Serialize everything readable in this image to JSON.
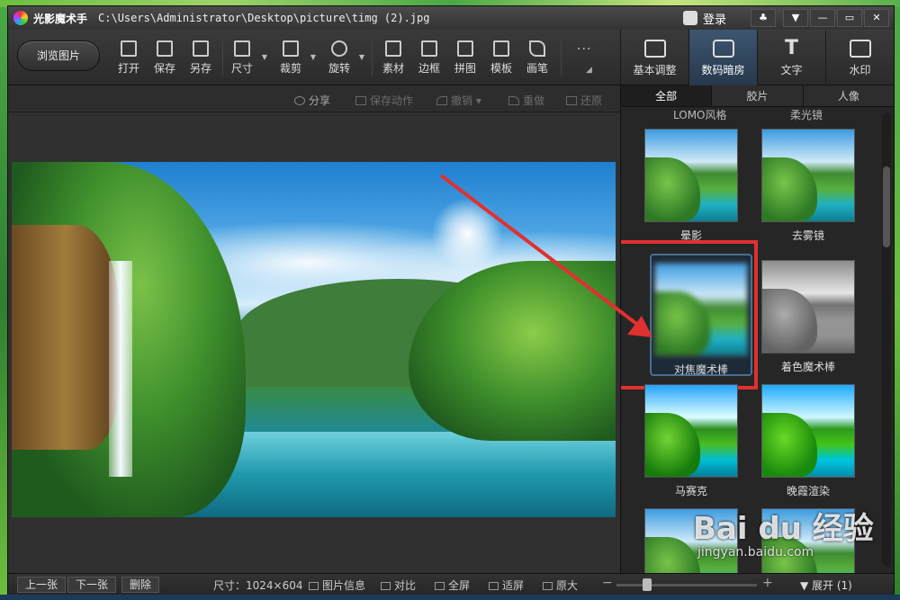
{
  "titlebar": {
    "app_name": "光影魔术手",
    "file_path": "C:\\Users\\Administrator\\Desktop\\picture\\timg (2).jpg",
    "login_label": "登录",
    "controls": [
      "♣",
      "▼",
      "—",
      "▭",
      "✕"
    ]
  },
  "toolbar": {
    "browse_label": "浏览图片",
    "tools": [
      {
        "label": "打开",
        "icon": "open-icon"
      },
      {
        "label": "保存",
        "icon": "save-icon"
      },
      {
        "label": "另存",
        "icon": "save-as-icon"
      },
      {
        "label": "尺寸",
        "icon": "resize-icon"
      },
      {
        "label": "裁剪",
        "icon": "crop-icon"
      },
      {
        "label": "旋转",
        "icon": "rotate-icon"
      },
      {
        "label": "素材",
        "icon": "material-icon"
      },
      {
        "label": "边框",
        "icon": "border-icon"
      },
      {
        "label": "拼图",
        "icon": "collage-icon"
      },
      {
        "label": "模板",
        "icon": "template-icon"
      },
      {
        "label": "画笔",
        "icon": "brush-icon"
      }
    ],
    "more": "···",
    "right_tabs": [
      {
        "label": "基本调整",
        "icon": "edit-icon"
      },
      {
        "label": "数码暗房",
        "icon": "camera-icon"
      },
      {
        "label": "文字",
        "icon": "text-icon",
        "glyph": "T"
      },
      {
        "label": "水印",
        "icon": "watermark-icon"
      }
    ]
  },
  "actions": {
    "share": "分享",
    "save_action": "保存动作",
    "undo": "撤销",
    "redo": "重做",
    "restore": "还原"
  },
  "panel": {
    "tabs": [
      "全部",
      "胶片",
      "人像"
    ],
    "top_labels": [
      "LOMO风格",
      "柔光镜"
    ],
    "items": [
      {
        "label": "晕影",
        "style": "normal"
      },
      {
        "label": "去雾镜",
        "style": "normal"
      },
      {
        "label": "对焦魔术棒",
        "style": "blur"
      },
      {
        "label": "着色魔术棒",
        "style": "gray"
      },
      {
        "label": "马赛克",
        "style": "mosaic"
      },
      {
        "label": "晚霞渲染",
        "style": "warm"
      },
      {
        "label": "",
        "style": "normal"
      },
      {
        "label": "",
        "style": "normal"
      }
    ]
  },
  "statusbar": {
    "prev": "上一张",
    "next": "下一张",
    "delete": "删除",
    "size": "尺寸：1024×604",
    "info": "图片信息",
    "compare": "对比",
    "fullscreen": "全屏",
    "fit": "适屏",
    "original": "原大",
    "expand": "展开 (1)"
  },
  "watermark": {
    "main": "Bai du 经验",
    "sub": "jingyan.baidu.com"
  },
  "colors": {
    "accent_tab": "#3d5670",
    "highlight": "#e03030",
    "arrow": "#e03030"
  }
}
